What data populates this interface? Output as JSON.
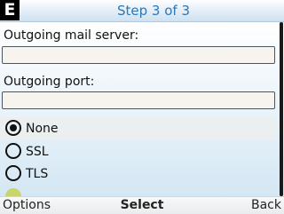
{
  "header": {
    "badge": "E",
    "title": "Step 3 of 3"
  },
  "form": {
    "outgoing_server_label": "Outgoing mail server:",
    "outgoing_server_value": "",
    "outgoing_port_label": "Outgoing port:",
    "outgoing_port_value": ""
  },
  "security_options": [
    {
      "label": "None",
      "selected": true
    },
    {
      "label": "SSL",
      "selected": false
    },
    {
      "label": "TLS",
      "selected": false
    }
  ],
  "softkeys": {
    "left": "Options",
    "center": "Select",
    "right": "Back"
  }
}
